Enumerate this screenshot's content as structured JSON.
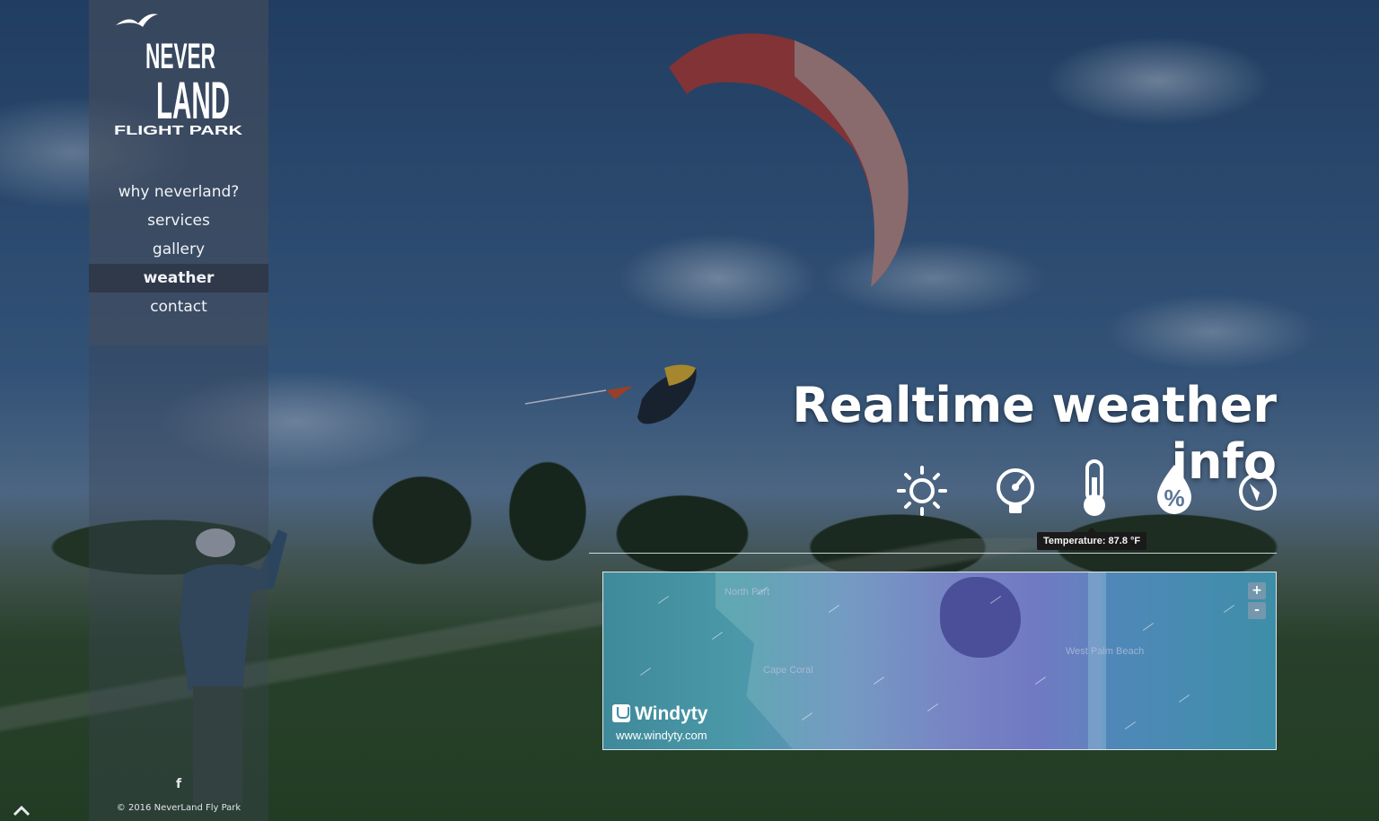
{
  "brand": {
    "logo_line1": "NEVER",
    "logo_line2": "LAND",
    "logo_line3": "FLIGHT PARK"
  },
  "nav": {
    "items": [
      {
        "label": "why neverland?"
      },
      {
        "label": "services"
      },
      {
        "label": "gallery"
      },
      {
        "label": "weather",
        "active": true
      },
      {
        "label": "contact"
      }
    ]
  },
  "footer": {
    "social_icon": "f",
    "copyright": "© 2016 NeverLand Fly Park"
  },
  "main": {
    "headline": "Realtime weather info",
    "weather_icons": [
      "sun-icon",
      "barometer-icon",
      "thermometer-icon",
      "humidity-icon",
      "wind-direction-icon"
    ],
    "tooltip": "Temperature: 87.8 °F"
  },
  "map": {
    "zoom_in": "+",
    "zoom_out": "-",
    "brand": "Windyty",
    "url": "www.windyty.com",
    "towns": [
      "North Port",
      "Cape Coral",
      "West Palm Beach"
    ]
  },
  "colors": {
    "accent_text": "#ffffff",
    "tooltip_bg": "#1a1a1a"
  }
}
